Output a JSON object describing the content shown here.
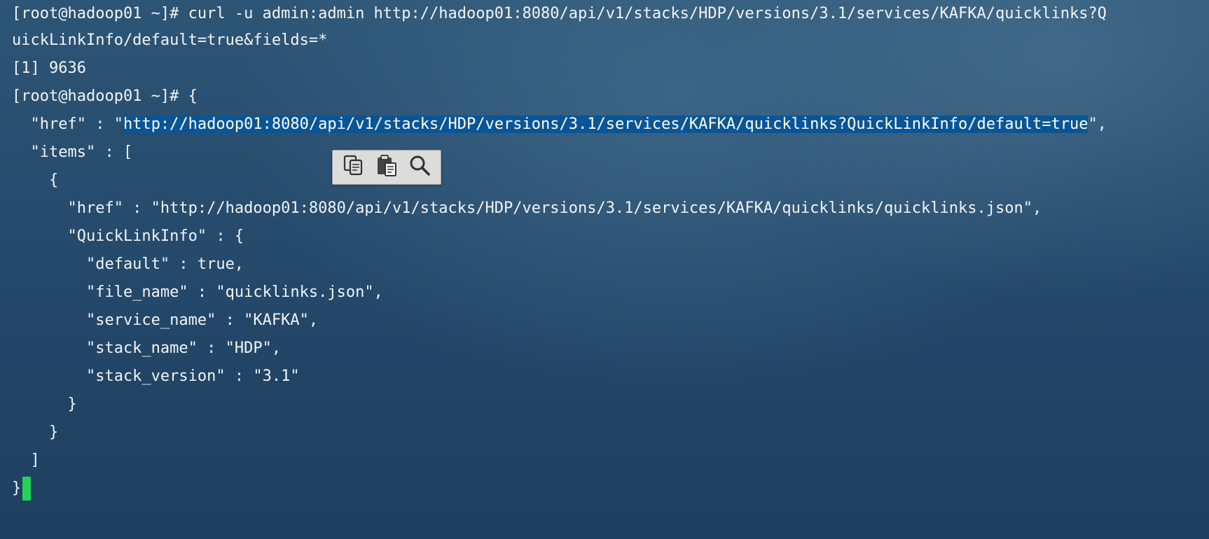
{
  "terminal": {
    "lines": [
      "[root@hadoop01 ~]# curl -u admin:admin http://hadoop01:8080/api/v1/stacks/HDP/versions/3.1/services/KAFKA/quicklinks?Q",
      "uickLinkInfo/default=true&fields=*",
      "[1] 9636",
      "[root@hadoop01 ~]# {"
    ],
    "href_line": {
      "before": "  \"href\" : \"",
      "selected": "http://hadoop01:8080/api/v1/stacks/HDP/versions/3.1/services/KAFKA/quicklinks?QuickLinkInfo/default=true",
      "after": "\","
    },
    "json_lines": [
      "  \"items\" : [",
      "    {",
      "      \"href\" : \"http://hadoop01:8080/api/v1/stacks/HDP/versions/3.1/services/KAFKA/quicklinks/quicklinks.json\",",
      "      \"QuickLinkInfo\" : {",
      "        \"default\" : true,",
      "        \"file_name\" : \"quicklinks.json\",",
      "        \"service_name\" : \"KAFKA\",",
      "        \"stack_name\" : \"HDP\",",
      "        \"stack_version\" : \"3.1\"",
      "      }",
      "    }",
      "  ]"
    ],
    "last_line": "}"
  },
  "popup": {
    "items": [
      {
        "icon": "copy-icon"
      },
      {
        "icon": "paste-icon"
      },
      {
        "icon": "search-icon"
      }
    ]
  },
  "colors": {
    "selection": "#0a5596",
    "cursor": "#22d454",
    "text": "#f2f4f6"
  }
}
